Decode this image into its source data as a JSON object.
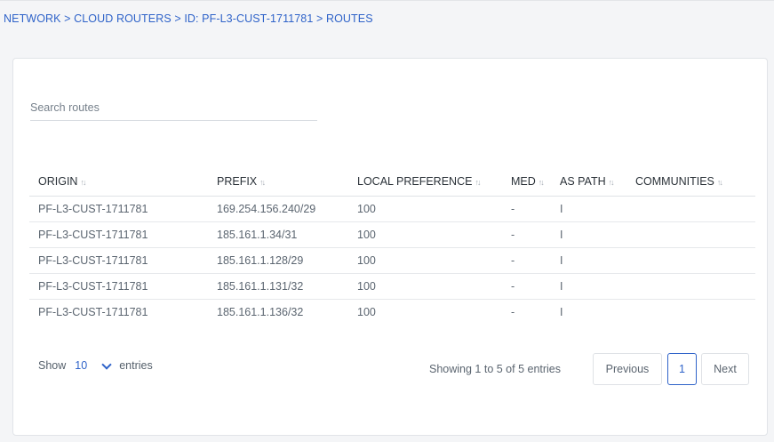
{
  "breadcrumb": "NETWORK > CLOUD ROUTERS > ID: PF-L3-CUST-1711781 > ROUTES",
  "search": {
    "placeholder": "Search routes",
    "value": ""
  },
  "table": {
    "columns": [
      "ORIGIN",
      "PREFIX",
      "LOCAL PREFERENCE",
      "MED",
      "AS PATH",
      "COMMUNITIES"
    ],
    "rows": [
      [
        "PF-L3-CUST-1711781",
        "169.254.156.240/29",
        "100",
        "-",
        "I",
        ""
      ],
      [
        "PF-L3-CUST-1711781",
        "185.161.1.34/31",
        "100",
        "-",
        "I",
        ""
      ],
      [
        "PF-L3-CUST-1711781",
        "185.161.1.128/29",
        "100",
        "-",
        "I",
        ""
      ],
      [
        "PF-L3-CUST-1711781",
        "185.161.1.131/32",
        "100",
        "-",
        "I",
        ""
      ],
      [
        "PF-L3-CUST-1711781",
        "185.161.1.136/32",
        "100",
        "-",
        "I",
        ""
      ]
    ]
  },
  "length": {
    "show_label": "Show",
    "selected": "10",
    "entries_label": "entries"
  },
  "info": "Showing 1 to 5 of 5 entries",
  "pagination": {
    "previous": "Previous",
    "current_page": "1",
    "next": "Next"
  },
  "colors": {
    "accent": "#2f63c9",
    "text": "#5b6570",
    "border": "#dfe2e6"
  }
}
